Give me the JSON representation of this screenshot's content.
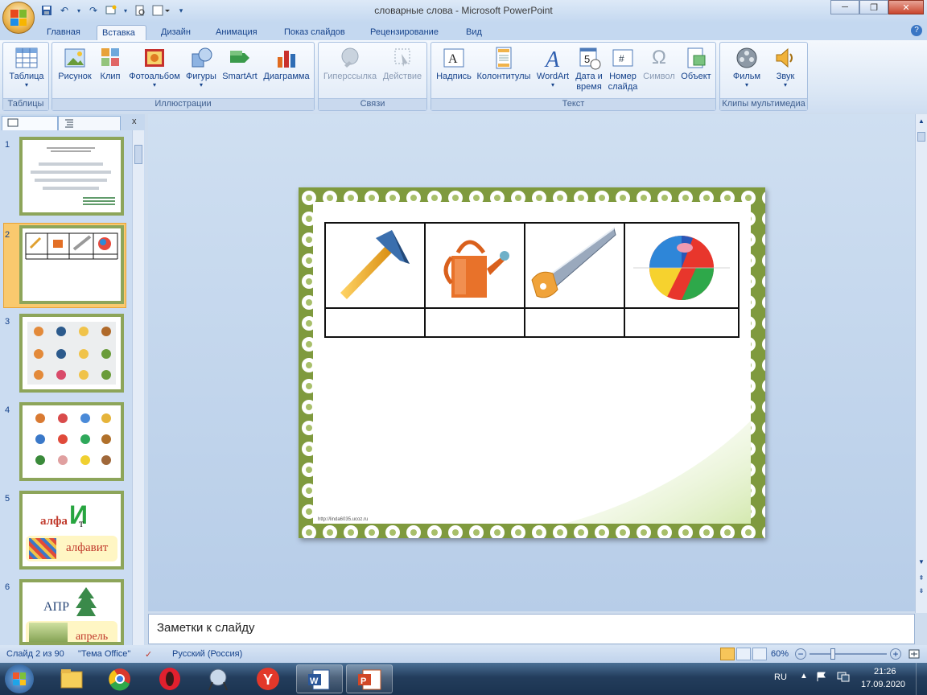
{
  "window": {
    "title": "словарные слова - Microsoft PowerPoint",
    "minimize": "─",
    "restore": "❐",
    "close": "✕"
  },
  "tabs": [
    {
      "label": "Главная"
    },
    {
      "label": "Вставка"
    },
    {
      "label": "Дизайн"
    },
    {
      "label": "Анимация"
    },
    {
      "label": "Показ слайдов"
    },
    {
      "label": "Рецензирование"
    },
    {
      "label": "Вид"
    }
  ],
  "help": "?",
  "ribbon": {
    "groups": {
      "tables": "Таблицы",
      "illustrations": "Иллюстрации",
      "links": "Связи",
      "text": "Текст",
      "media": "Клипы мультимедиа"
    },
    "buttons": {
      "table": "Таблица",
      "picture": "Рисунок",
      "clip": "Клип",
      "photoalbum": "Фотоальбом",
      "shapes": "Фигуры",
      "smartart": "SmartArt",
      "chart": "Диаграмма",
      "hyperlink": "Гиперссылка",
      "action": "Действие",
      "textbox": "Надпись",
      "headerfooter": "Колонтитулы",
      "wordart": "WordArt",
      "datetime_1": "Дата и",
      "datetime_2": "время",
      "slidenum_1": "Номер",
      "slidenum_2": "слайда",
      "symbol": "Символ",
      "object": "Объект",
      "movie": "Фильм",
      "sound": "Звук"
    }
  },
  "slides_panel": {
    "close": "x",
    "numbers": [
      "1",
      "2",
      "3",
      "4",
      "5",
      "6"
    ],
    "slide5": {
      "word_part": "алфа",
      "big_letter": "И",
      "small_letter": "т",
      "word": "алфавит"
    },
    "slide6": {
      "word_part": "АПР",
      "word": "апрель"
    }
  },
  "slide": {
    "footer_url": "http://linda6035.ucoz.ru"
  },
  "notes": {
    "placeholder": "Заметки к слайду"
  },
  "status": {
    "slide_counter": "Слайд 2 из 90",
    "theme": "\"Тема Office\"",
    "language": "Русский (Россия)",
    "zoom": "60%",
    "zoom_level": 0.6
  },
  "taskbar": {
    "lang": "RU",
    "time": "21:26",
    "date": "17.09.2020"
  },
  "colors": {
    "ribbon_bg": "#dbe7f5",
    "accent": "#15428b",
    "slide_border": "#7f9a3e",
    "selected_thumb": "#f9c96e"
  }
}
